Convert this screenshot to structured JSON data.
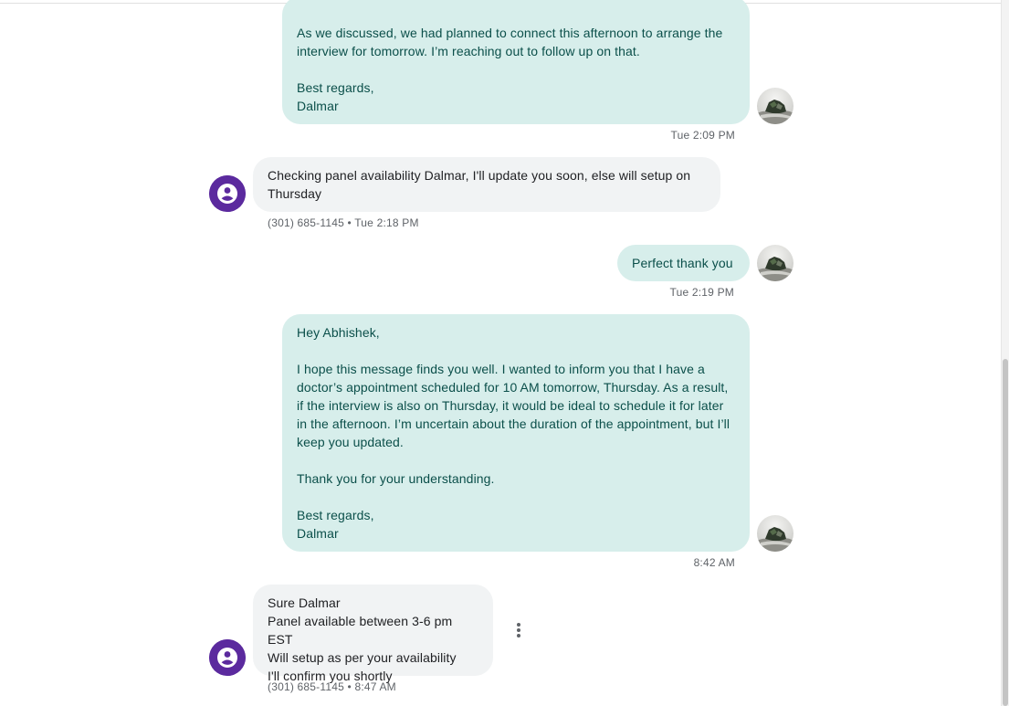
{
  "messages": [
    {
      "direction": "outgoing",
      "lines": [
        "As we discussed, we had planned to connect this afternoon to arrange the",
        "interview for tomorrow. I’m reaching out to follow up on that."
      ],
      "signoff": [
        "Best regards,",
        "Dalmar"
      ],
      "meta": "Tue 2:09 PM"
    },
    {
      "direction": "incoming",
      "text": "Checking panel availability Dalmar, I'll update you soon, else will setup on Thursday",
      "meta": "(301) 685-1145 • Tue 2:18 PM"
    },
    {
      "direction": "outgoing",
      "text": "Perfect thank you",
      "meta": "Tue 2:19 PM"
    },
    {
      "direction": "outgoing",
      "greeting": "Hey Abhishek,",
      "body": "I hope this message finds you well. I wanted to inform you that I have a doctor’s appointment scheduled for 10 AM tomorrow, Thursday. As a result, if the interview is also on Thursday, it would be ideal to schedule it for later in the afternoon. I’m uncertain about the duration of the appointment, but I’ll keep you updated.",
      "thanks": "Thank you for your understanding.",
      "signoff": [
        "Best regards,",
        "Dalmar"
      ],
      "meta": "8:42 AM"
    },
    {
      "direction": "incoming",
      "lines": [
        "Sure Dalmar",
        "Panel available between 3-6 pm EST",
        "Will setup as per your availability",
        "I'll confirm you shortly"
      ],
      "meta": "(301) 685-1145 • 8:47 AM"
    }
  ],
  "icons": {
    "self_avatar": "user-photo-avatar",
    "contact_avatar": "person-icon",
    "more": "more-vert-icon"
  },
  "colors": {
    "outgoing_bubble": "#d7eeeb",
    "outgoing_text": "#0b4f4a",
    "incoming_bubble": "#f1f3f4",
    "contact_avatar": "#5b2a9e"
  }
}
